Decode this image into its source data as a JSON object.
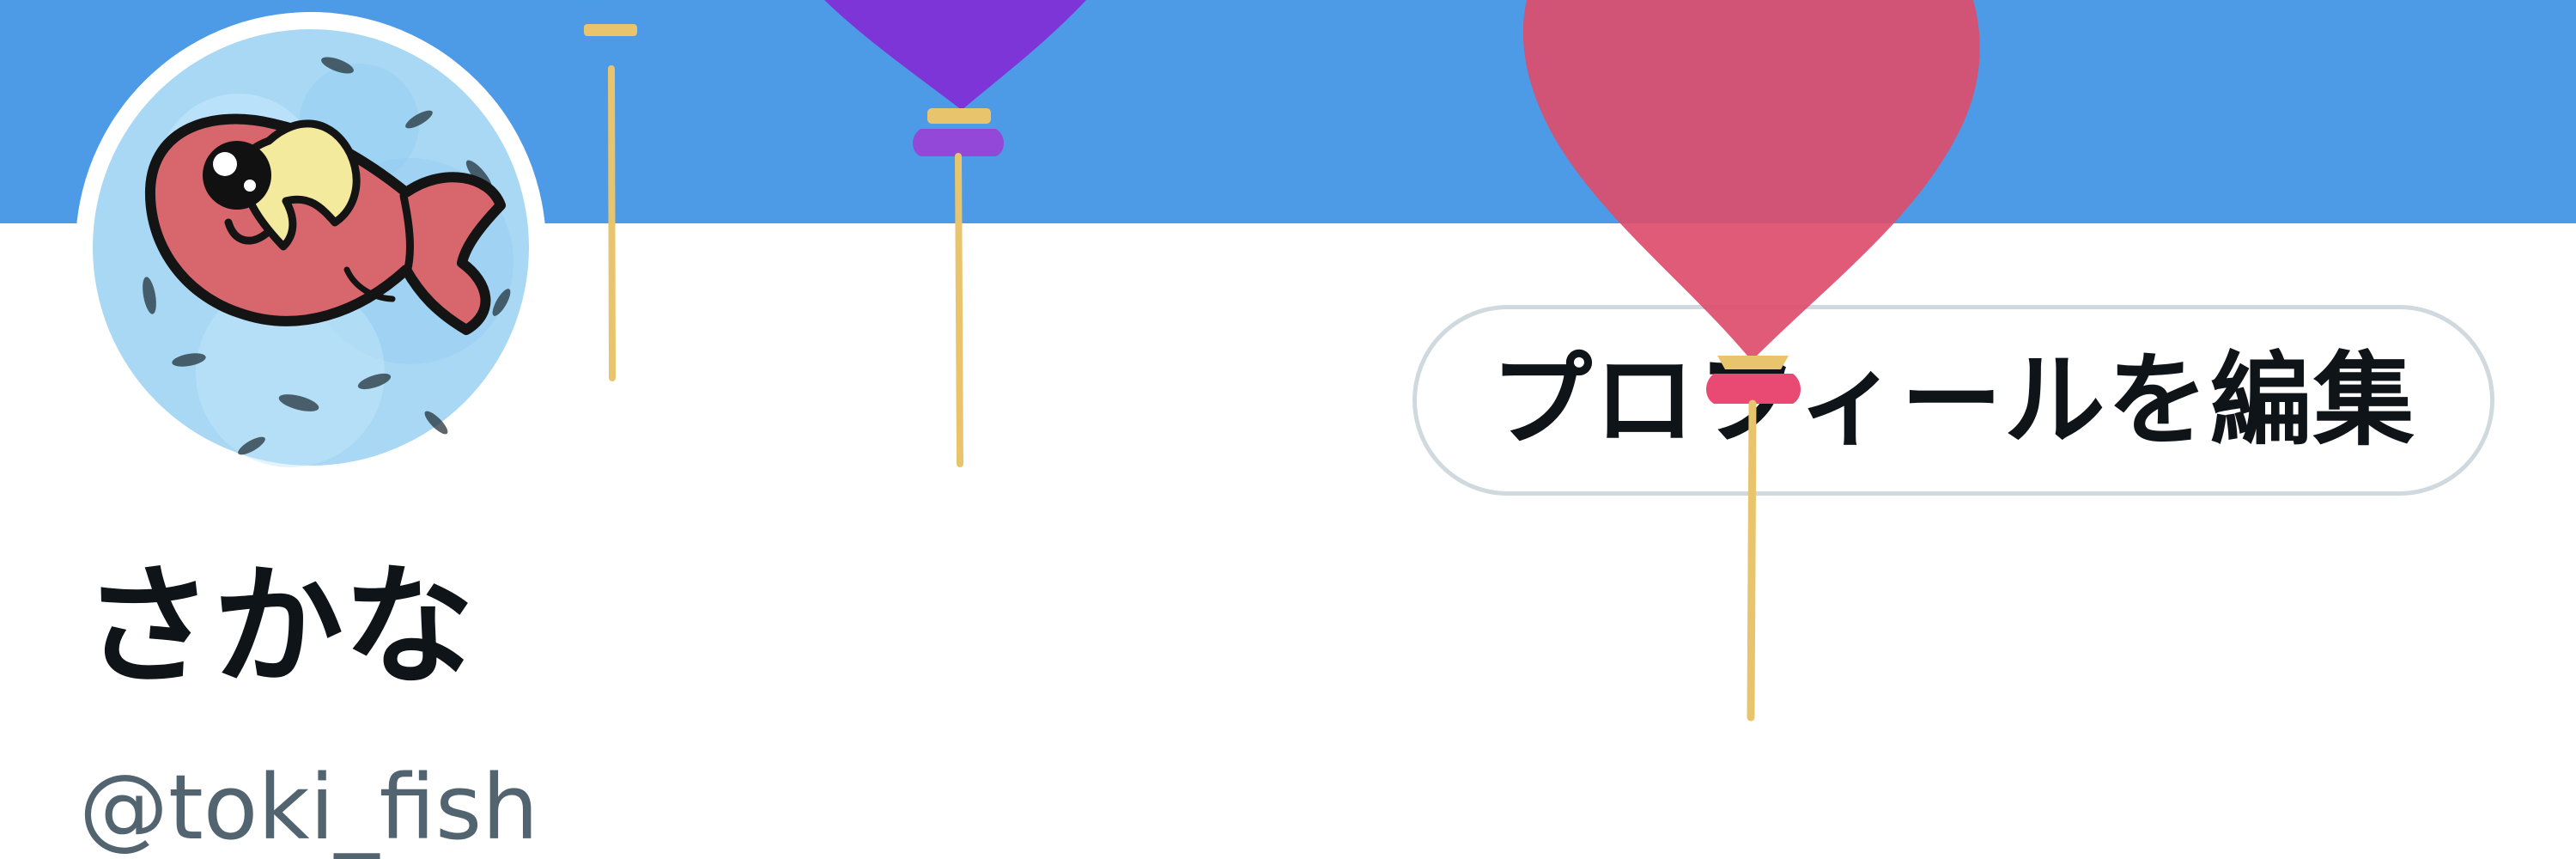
{
  "profile": {
    "display_name": "さかな",
    "handle": "@toki_fish",
    "edit_profile_label": "プロフィールを編集"
  },
  "header": {
    "banner_color": "#4d9be6"
  },
  "decorations": {
    "balloon_colors": [
      "#4d9be6",
      "#7d35d8",
      "#dc4d6d"
    ],
    "string_color": "#e8c56d"
  },
  "avatar": {
    "icon": "fish-icon",
    "background_color": "#a9d8f5",
    "fish_color": "#d8666d",
    "hair_color": "#f3ea9e"
  }
}
